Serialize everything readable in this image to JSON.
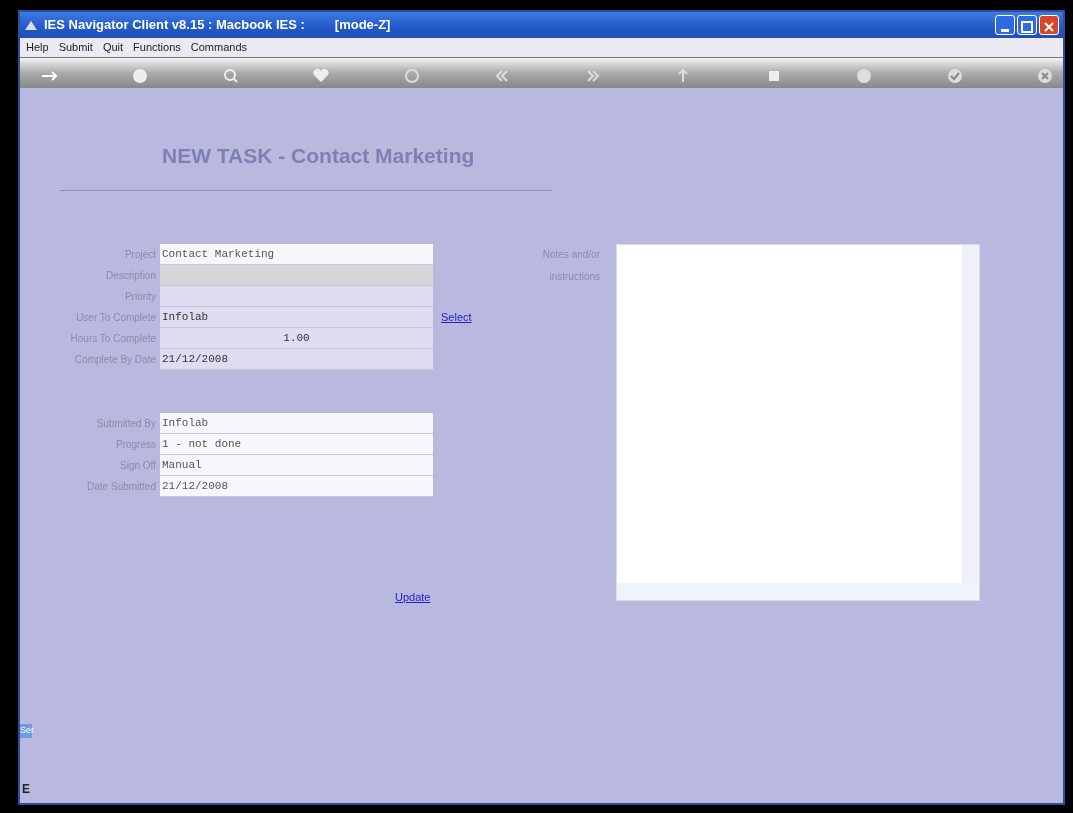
{
  "window": {
    "title": "IES Navigator Client v8.15 : Macbook IES :",
    "mode": "[mode-Z]"
  },
  "menu": [
    "Help",
    "Submit",
    "Quit",
    "Functions",
    "Commands"
  ],
  "heading": "NEW TASK - Contact Marketing",
  "task_fields": [
    {
      "label": "Project",
      "value": "Contact Marketing",
      "kind": "readonly"
    },
    {
      "label": "Description",
      "kind": "focused"
    },
    {
      "label": "Priority",
      "kind": "editable"
    },
    {
      "label": "User To Complete",
      "value": "Infolab",
      "kind": "editable"
    },
    {
      "label": "Hours To Complete",
      "value": "1.00",
      "kind": "number"
    },
    {
      "label": "Complete By Date",
      "value": "21/12/2008",
      "kind": "editable"
    }
  ],
  "select_link": "Select",
  "status_fields": [
    {
      "label": "Submitted By",
      "value": "Infolab",
      "kind": "readonly"
    },
    {
      "label": "Progress",
      "value": "1 - not done",
      "kind": "readonly"
    },
    {
      "label": "Sign Off",
      "value": "Manual",
      "kind": "readonly"
    },
    {
      "label": "Date Submitted",
      "value": "21/12/2008",
      "kind": "readonly"
    }
  ],
  "update_link": "Update",
  "notes": {
    "label": "Notes and/or instructions"
  },
  "side_tab": {
    "label": "Ser",
    "letter": "E"
  }
}
